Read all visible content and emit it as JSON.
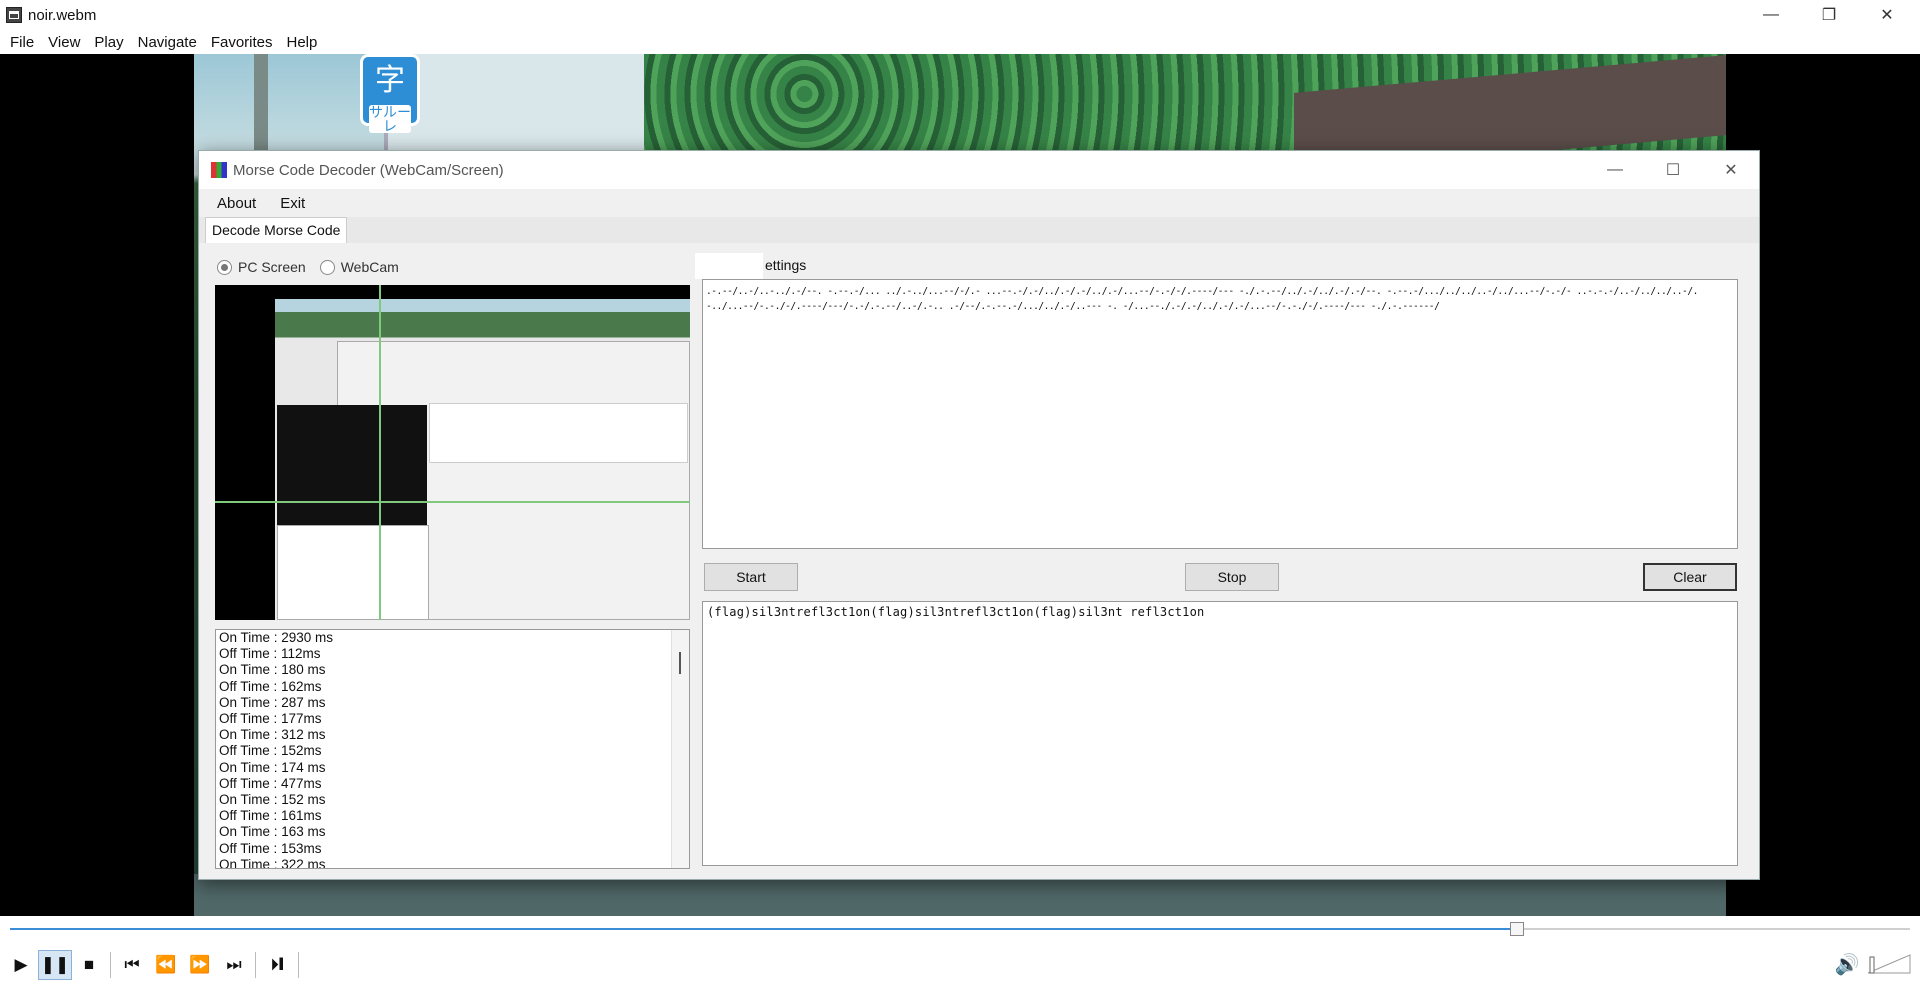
{
  "window": {
    "title": "noir.webm",
    "minimize": "—",
    "restore": "❐",
    "close": "✕"
  },
  "menu": [
    "File",
    "View",
    "Play",
    "Navigate",
    "Favorites",
    "Help"
  ],
  "sign": {
    "top": "字",
    "bottom": "サルーレ"
  },
  "decoder": {
    "title": "Morse Code Decoder (WebCam/Screen)",
    "controls": {
      "minimize": "—",
      "maximize": "☐",
      "close": "✕"
    },
    "menu": [
      "About",
      "Exit"
    ],
    "tab": "Decode Morse Code",
    "sources": {
      "pc_screen": "PC Screen",
      "webcam": "WebCam",
      "selected": "PC Screen"
    },
    "settings_tab": "ettings",
    "morse_text": ".-.--/..-/..-../.-/--. -.--.-/... ../.-../...--/-/.- ...--.-/.-/../.-/.-/../.-/...--/-.-/-/.----/--- -./.-.--/../.-/../.-/.-/--. -.--.-/.../../../..-/../...--/-.-/- ..-.-.-/..-/../../..-/.-../...--/-.-./-/.----/---/-.-/.-.--/..-/.-.. .-/--/.-.--.-/.../../.-/..--- -. -/...--./.-/.-/../.-/.-/...--/-.-./-/.----/--- -./.-.------/",
    "buttons": {
      "start": "Start",
      "stop": "Stop",
      "clear": "Clear"
    },
    "output_text": "(flag)sil3ntrefl3ct1on(flag)sil3ntrefl3ct1on(flag)sil3nt refl3ct1on",
    "log": [
      "On Time : 2930 ms",
      "Off Time : 112ms",
      "On Time : 180 ms",
      "Off Time : 162ms",
      "On Time : 287 ms",
      "Off Time : 177ms",
      "On Time : 312 ms",
      "Off Time : 152ms",
      "On Time : 174 ms",
      "Off Time : 477ms",
      "On Time : 152 ms",
      "Off Time : 161ms",
      "On Time : 163 ms",
      "Off Time : 153ms",
      "On Time : 322 ms"
    ]
  },
  "player": {
    "seek_fraction": 0.793,
    "buttons": [
      "play",
      "pause",
      "stop",
      "skip-back",
      "rewind",
      "fast-forward",
      "skip-forward",
      "frame-step"
    ],
    "glyphs": {
      "play": "▶",
      "pause": "❚❚",
      "stop": "■",
      "skip-back": "⏮",
      "rewind": "⏪",
      "fast-forward": "⏩",
      "skip-forward": "⏭",
      "frame-step": "⏵❙",
      "volume": "🔊"
    }
  }
}
